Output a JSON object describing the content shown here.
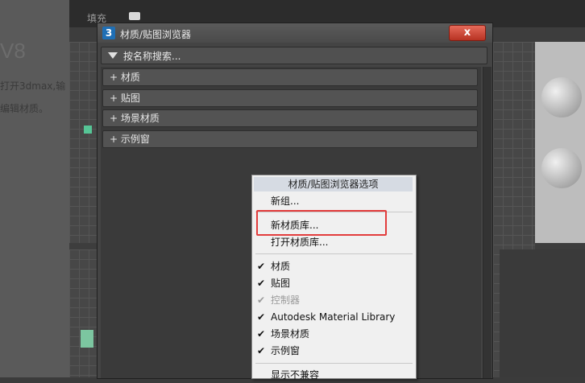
{
  "background": {
    "side_text_big": "V8",
    "side_text_1": "打开3dmax,输",
    "side_text_2": "编辑材质。",
    "toolbar_label": "填充"
  },
  "dialog": {
    "title": "材质/贴图浏览器",
    "app_icon": "3",
    "close_glyph": "x",
    "search_placeholder": "按名称搜索...",
    "rollouts": [
      "+ 材质",
      "+ 贴图",
      "+ 场景材质",
      "+ 示例窗"
    ]
  },
  "menu": {
    "header": "材质/贴图浏览器选项",
    "items": [
      {
        "label": "新组...",
        "checked": false,
        "disabled": false
      },
      {
        "label": "新材质库...",
        "checked": false,
        "disabled": false
      },
      {
        "label": "打开材质库...",
        "checked": false,
        "disabled": false
      },
      {
        "label": "材质",
        "checked": true,
        "disabled": false
      },
      {
        "label": "贴图",
        "checked": true,
        "disabled": false
      },
      {
        "label": "控制器",
        "checked": true,
        "disabled": true
      },
      {
        "label": "Autodesk Material Library",
        "checked": true,
        "disabled": false
      },
      {
        "label": "场景材质",
        "checked": true,
        "disabled": false
      },
      {
        "label": "示例窗",
        "checked": true,
        "disabled": false
      },
      {
        "label": "显示不兼容",
        "checked": false,
        "disabled": false
      }
    ],
    "check_glyph": "✔"
  },
  "colors": {
    "highlight": "#e23c3c",
    "close_button": "#c8402f",
    "menu_bg": "#f0f0f0"
  }
}
